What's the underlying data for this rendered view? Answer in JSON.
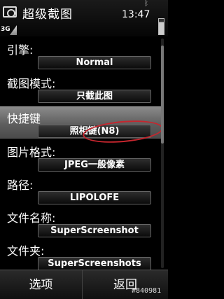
{
  "status_bar": {
    "app_title": "超级截图",
    "time": "13:47",
    "network": "3G",
    "icons": [
      "camera-app-icon",
      "bluetooth-icon",
      "signal-icon",
      "battery-icon"
    ]
  },
  "settings": [
    {
      "label": "引擎:",
      "value": "Normal"
    },
    {
      "label": "截图模式:",
      "value": "只截此图"
    },
    {
      "label": "快捷键",
      "value": "照相键(N8)",
      "selected": true
    },
    {
      "label": "图片格式:",
      "value": "JPEG一般像素"
    },
    {
      "label": "路径:",
      "value": "LIPOLOFE"
    },
    {
      "label": "文件名称:",
      "value": "SuperScreenshot"
    },
    {
      "label": "文件夹:",
      "value": "SuperScreenshots"
    }
  ],
  "softkeys": {
    "left": "选项",
    "right": "返回"
  },
  "watermark": "#840981",
  "colors": {
    "annotation_circle": "#c6262e",
    "selected_row": "#6e6e6e"
  }
}
